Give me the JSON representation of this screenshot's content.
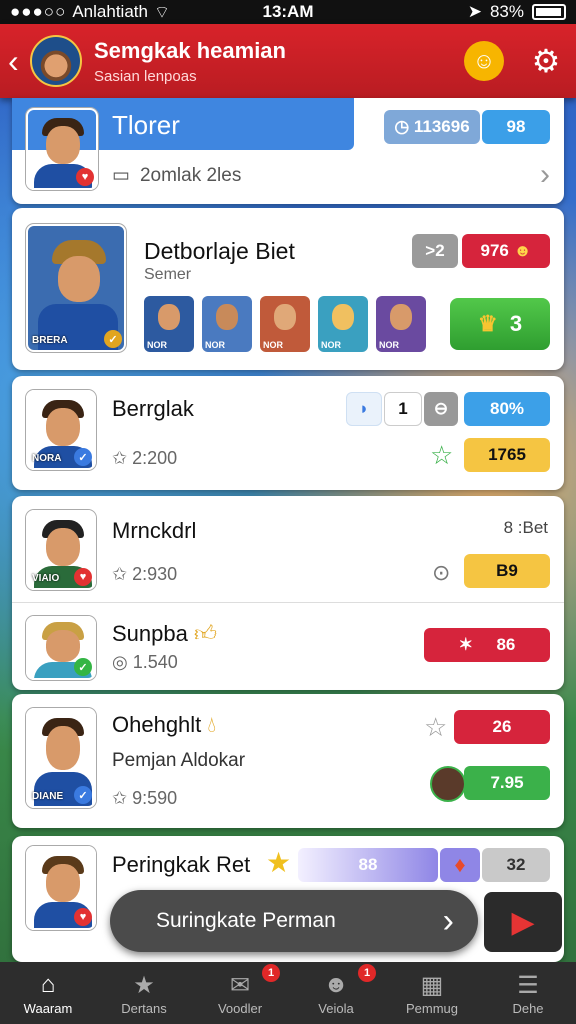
{
  "status": {
    "carrier": "Anlahtiath",
    "time": "13:AM",
    "battery": "83%"
  },
  "header": {
    "title": "Semgkak heamian",
    "subtitle": "Sasian lenpoas"
  },
  "top_card": {
    "tab_label": "Tlorer",
    "stat1": "113696",
    "stat2": "98",
    "link_text": "2omlak 2les"
  },
  "featured": {
    "name": "Detborlaje Biet",
    "sub": "Semer",
    "pill1": "2",
    "pill2": "976",
    "avatar_tag": "BRERA",
    "small_tags": [
      "NOR",
      "NOR",
      "NOR",
      "NOR",
      "NOR"
    ],
    "green_value": "3"
  },
  "rows": [
    {
      "name": "Berrglak",
      "score": "2:200",
      "tag": "NORA",
      "count": "1",
      "pct": "80%",
      "points": "1765"
    },
    {
      "name": "Mrnckdrl",
      "score": "2:930",
      "tag": "VIAIO",
      "rank_label": "8 :Bet",
      "points": "B9"
    },
    {
      "name": "Sunpba",
      "score": "1.540",
      "points": "86"
    },
    {
      "name": "Ohehghlt",
      "sub": "Pemjan Aldokar",
      "score": "9:590",
      "tag": "DIANE",
      "points_red": "26",
      "points_green": "7.95"
    },
    {
      "name": "Peringkak Ret",
      "bar_value": "88",
      "value": "32"
    }
  ],
  "cta": {
    "label": "Suringkate Perman"
  },
  "tabs": [
    {
      "label": "Waaram",
      "icon": "home-icon"
    },
    {
      "label": "Dertans",
      "icon": "star-icon"
    },
    {
      "label": "Voodler",
      "icon": "mail-icon",
      "badge": "1"
    },
    {
      "label": "Veiola",
      "icon": "face-icon",
      "badge": "1"
    },
    {
      "label": "Pemmug",
      "icon": "calendar-icon"
    },
    {
      "label": "Dehe",
      "icon": "menu-icon"
    }
  ]
}
